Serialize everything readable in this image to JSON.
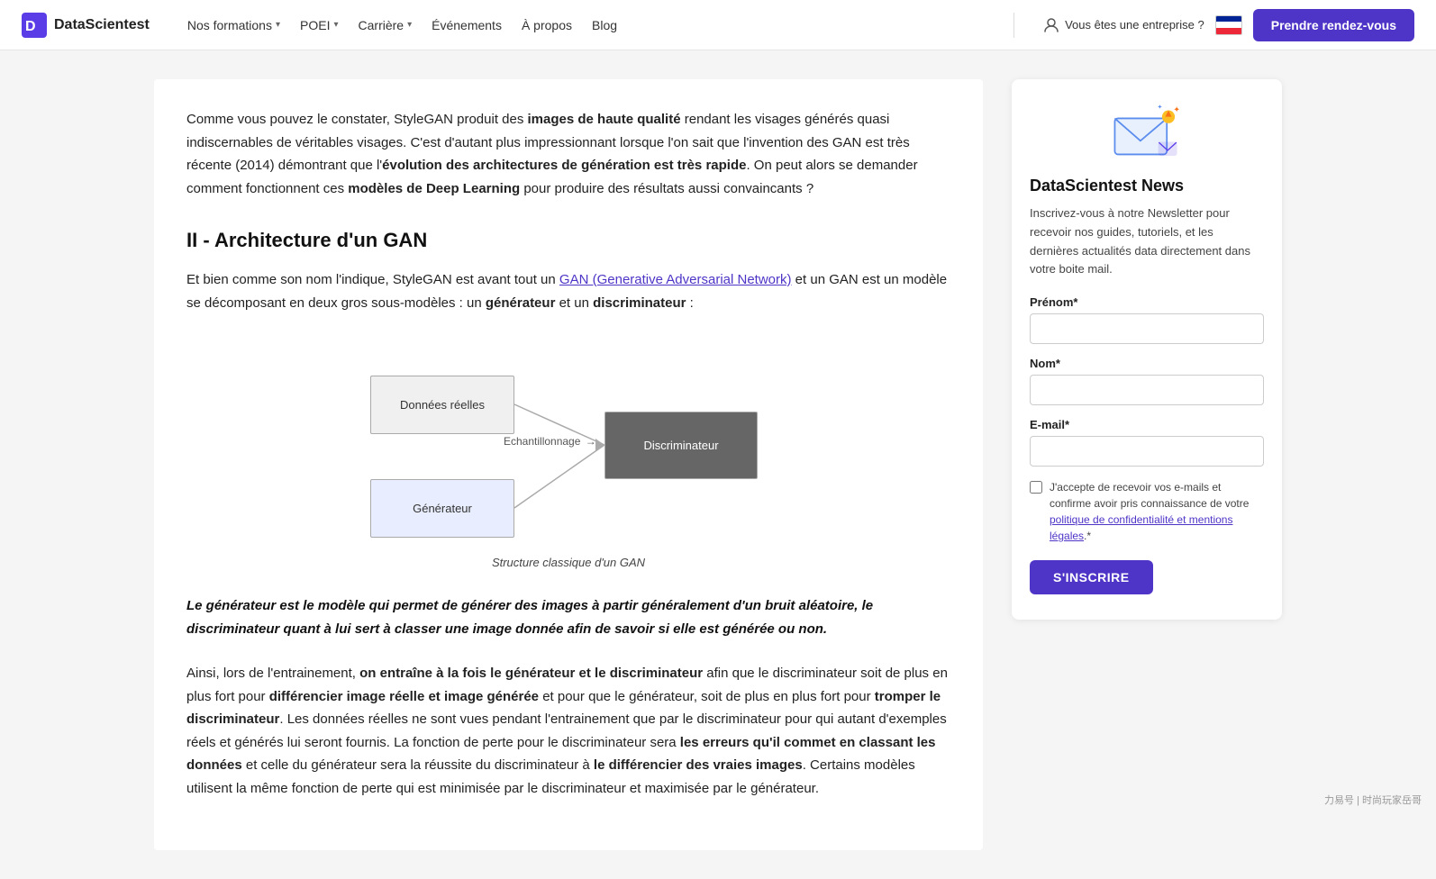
{
  "nav": {
    "logo_text": "DataScientest",
    "links": [
      {
        "label": "Nos formations",
        "has_dropdown": true
      },
      {
        "label": "POEI",
        "has_dropdown": true
      },
      {
        "label": "Carrière",
        "has_dropdown": true
      },
      {
        "label": "Événements",
        "has_dropdown": false
      },
      {
        "label": "À propos",
        "has_dropdown": false
      },
      {
        "label": "Blog",
        "has_dropdown": false
      }
    ],
    "enterprise_label": "Vous êtes une entreprise ?",
    "cta_label": "Prendre rendez-vous"
  },
  "article": {
    "intro_para": "Comme vous pouvez le constater, StyleGAN produit des images de haute qualité rendant les visages générés quasi indiscernables de véritables visages. C'est d'autant plus impressionnant lorsque l'on sait que l'invention des GAN est très récente (2014) démontrant que l'évolution des architectures de génération est très rapide. On peut alors se demander comment fonctionnent ces modèles de Deep Learning pour produire des résultats aussi convaincants ?",
    "intro_bold1": "images de haute qualité",
    "intro_bold2": "évolution des architectures de génération est très rapide",
    "intro_bold3": "modèles de Deep Learning",
    "section_title": "II - Architecture d'un GAN",
    "section_para1_pre": "Et bien comme son nom l'indique, StyleGAN est avant tout un ",
    "section_para1_link": "GAN (Generative Adversarial Network)",
    "section_para1_post": " et un GAN est un modèle se décomposant en deux gros sous-modèles : un générateur et un discriminateur :",
    "diagram_caption": "Structure classique d'un GAN",
    "diagram_box1": "Données réelles",
    "diagram_box2": "Générateur",
    "diagram_box3": "Discriminateur",
    "diagram_arrow_label": "Echantillonnage",
    "blockquote": "Le générateur est le modèle qui permet de générer des images à partir généralement d'un bruit aléatoire, le discriminateur quant à lui sert à classer une image donnée afin de savoir si elle est générée ou non.",
    "para2_pre": "Ainsi, lors de l'entrainement, ",
    "para2_bold1": "on entraîne à la fois le générateur et le discriminateur",
    "para2_mid1": " afin que le discriminateur soit de plus en plus fort pour ",
    "para2_bold2": "différencier image réelle et image générée",
    "para2_mid2": " et pour que le générateur, soit de plus en plus fort pour ",
    "para2_bold3": "tromper le discriminateur",
    "para2_rest": ". Les données réelles ne sont vues pendant l'entrainement que par le discriminateur pour qui autant d'exemples réels et générés lui seront fournis. La fonction de perte pour le discriminateur sera ",
    "para2_bold4": "les erreurs qu'il commet en classant les données",
    "para2_mid3": " et celle du générateur sera la réussite du discriminateur à ",
    "para2_bold5": "le différencier des vraies images",
    "para2_end": ". Certains modèles utilisent la même fonction de perte qui est minimisée par le discriminateur et maximisée par le générateur."
  },
  "newsletter": {
    "title": "DataScientest News",
    "description": "Inscrivez-vous à notre Newsletter pour recevoir nos guides, tutoriels, et les dernières actualités data directement dans votre boite mail.",
    "prenom_label": "Prénom*",
    "nom_label": "Nom*",
    "email_label": "E-mail*",
    "checkbox_text": "J'accepte de recevoir vos e-mails et confirme avoir pris connaissance de votre politique de confidentialité et mentions légales.*",
    "subscribe_btn": "S'INSCRIRE"
  },
  "watermark": "力易号 | 时尚玩家岳哥"
}
